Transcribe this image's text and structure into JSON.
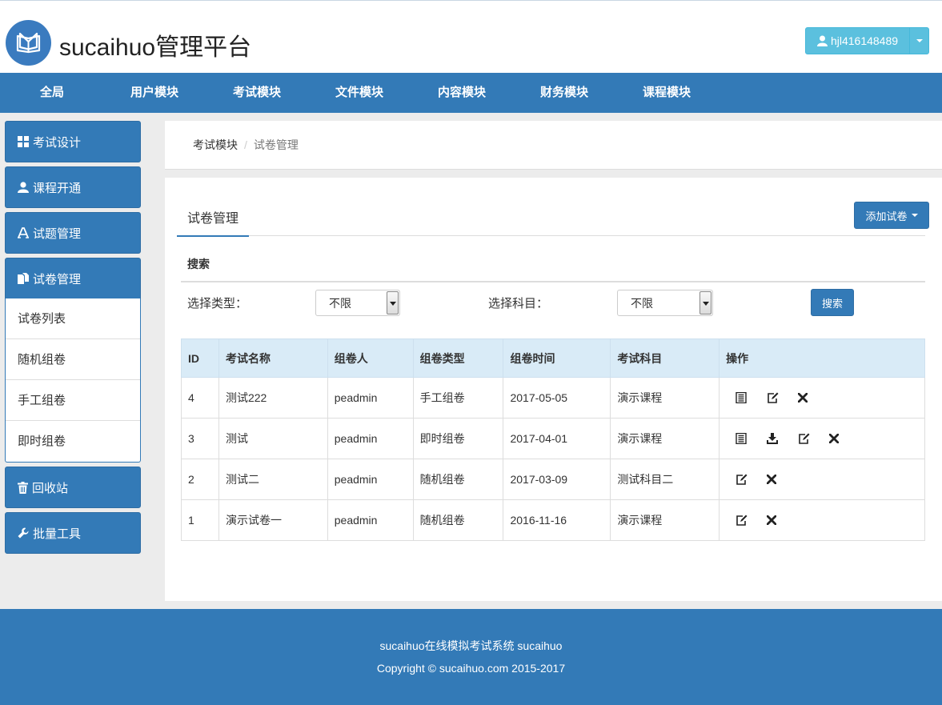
{
  "header": {
    "brand": "sucaihuo管理平台",
    "username": "hjl416148489"
  },
  "nav": [
    {
      "label": "全局"
    },
    {
      "label": "用户模块"
    },
    {
      "label": "考试模块"
    },
    {
      "label": "文件模块"
    },
    {
      "label": "内容模块"
    },
    {
      "label": "财务模块"
    },
    {
      "label": "课程模块"
    }
  ],
  "sidebar": {
    "items": [
      {
        "label": "考试设计",
        "icon": "grid-icon"
      },
      {
        "label": "课程开通",
        "icon": "user-icon"
      },
      {
        "label": "试题管理",
        "icon": "text-icon"
      },
      {
        "label": "试卷管理",
        "icon": "file-icon"
      },
      {
        "label": "回收站",
        "icon": "trash-icon"
      },
      {
        "label": "批量工具",
        "icon": "wrench-icon"
      }
    ],
    "sub_items": [
      {
        "label": "试卷列表"
      },
      {
        "label": "随机组卷"
      },
      {
        "label": "手工组卷"
      },
      {
        "label": "即时组卷"
      }
    ]
  },
  "breadcrumb": {
    "parent": "考试模块",
    "sep": "/",
    "current": "试卷管理"
  },
  "main": {
    "tab": "试卷管理",
    "add_button": "添加试卷",
    "search_title": "搜索",
    "filter_type_label": "选择类型：",
    "filter_type_value": "不限",
    "filter_subject_label": "选择科目：",
    "filter_subject_value": "不限",
    "search_button": "搜索"
  },
  "table": {
    "headers": [
      "ID",
      "考试名称",
      "组卷人",
      "组卷类型",
      "组卷时间",
      "考试科目",
      "操作"
    ],
    "rows": [
      {
        "id": "4",
        "name": "测试222",
        "creator": "peadmin",
        "type": "手工组卷",
        "date": "2017-05-05",
        "subject": "演示课程",
        "ops": [
          "list-icon",
          "edit-icon",
          "delete-icon"
        ]
      },
      {
        "id": "3",
        "name": "测试",
        "creator": "peadmin",
        "type": "即时组卷",
        "date": "2017-04-01",
        "subject": "演示课程",
        "ops": [
          "list-icon",
          "download-icon",
          "edit-icon",
          "delete-icon"
        ]
      },
      {
        "id": "2",
        "name": "测试二",
        "creator": "peadmin",
        "type": "随机组卷",
        "date": "2017-03-09",
        "subject": "测试科目二",
        "ops": [
          "edit-icon",
          "delete-icon"
        ]
      },
      {
        "id": "1",
        "name": "演示试卷一",
        "creator": "peadmin",
        "type": "随机组卷",
        "date": "2016-11-16",
        "subject": "演示课程",
        "ops": [
          "edit-icon",
          "delete-icon"
        ]
      }
    ]
  },
  "footer": {
    "line1": "sucaihuo在线模拟考试系统 sucaihuo",
    "line2": "Copyright © sucaihuo.com 2015-2017"
  },
  "colors": {
    "primary": "#337ab7",
    "info": "#5bc0de",
    "table_header": "#d9ebf7"
  }
}
